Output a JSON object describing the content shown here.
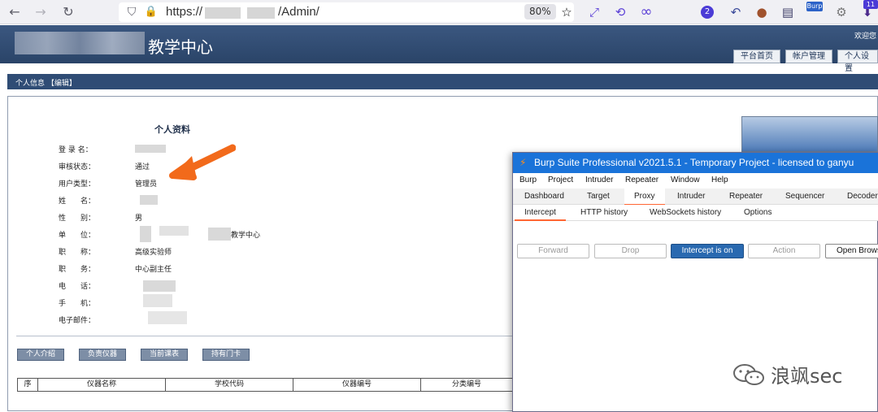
{
  "browser": {
    "url_prefix": "https://",
    "url_suffix": "/Admin/",
    "zoom": "80%",
    "badge_count": "2",
    "ext_label_burp": "Burp",
    "ext_count": "11"
  },
  "site": {
    "title": "教学中心",
    "welcome": "欢迎您",
    "nav_tabs": [
      "平台首页",
      "帐户管理",
      "个人设置"
    ],
    "sub_bar": "个人信息 【编辑】"
  },
  "profile": {
    "title": "个人资料",
    "rows": [
      {
        "label": "登 录 名：",
        "value": ""
      },
      {
        "label": "审核状态：",
        "value": "通过"
      },
      {
        "label": "用户类型：",
        "value": "管理员"
      },
      {
        "label": "姓　　名：",
        "value": ""
      },
      {
        "label": "性　　别：",
        "value": "男"
      },
      {
        "label": "单　　位：",
        "value": "教学中心"
      },
      {
        "label": "职　　称：",
        "value": "高级实验师"
      },
      {
        "label": "职　　务：",
        "value": "中心副主任"
      },
      {
        "label": "电　　话：",
        "value": ""
      },
      {
        "label": "手　　机：",
        "value": ""
      },
      {
        "label": "电子邮件：",
        "value": ""
      }
    ],
    "tabs": [
      "个人介绍",
      "负责仪器",
      "当前课表",
      "持有门卡"
    ],
    "table_headers": [
      "序",
      "仪器名称",
      "学校代码",
      "仪器编号",
      "分类编号"
    ]
  },
  "burp": {
    "title": "Burp Suite Professional v2021.5.1 - Temporary Project - licensed to ganyu",
    "menu": [
      "Burp",
      "Project",
      "Intruder",
      "Repeater",
      "Window",
      "Help"
    ],
    "tabs": [
      "Dashboard",
      "Target",
      "Proxy",
      "Intruder",
      "Repeater",
      "Sequencer",
      "Decoder"
    ],
    "active_tab": "Proxy",
    "subtabs": [
      "Intercept",
      "HTTP history",
      "WebSockets history",
      "Options"
    ],
    "active_subtab": "Intercept",
    "buttons": [
      "Forward",
      "Drop",
      "Intercept is on",
      "Action",
      "Open Browser"
    ]
  },
  "watermark": "浪飒sec",
  "colors": {
    "header_blue": "#2a4468",
    "burp_titlebar": "#1a73d9",
    "burp_accent": "#ff6633",
    "arrow_orange": "#f26a1b"
  },
  "icons": [
    "back-icon",
    "forward-icon",
    "reload-icon",
    "shield-icon",
    "lock-icon",
    "star-icon",
    "expand-icon",
    "history-icon",
    "infinity-icon"
  ]
}
